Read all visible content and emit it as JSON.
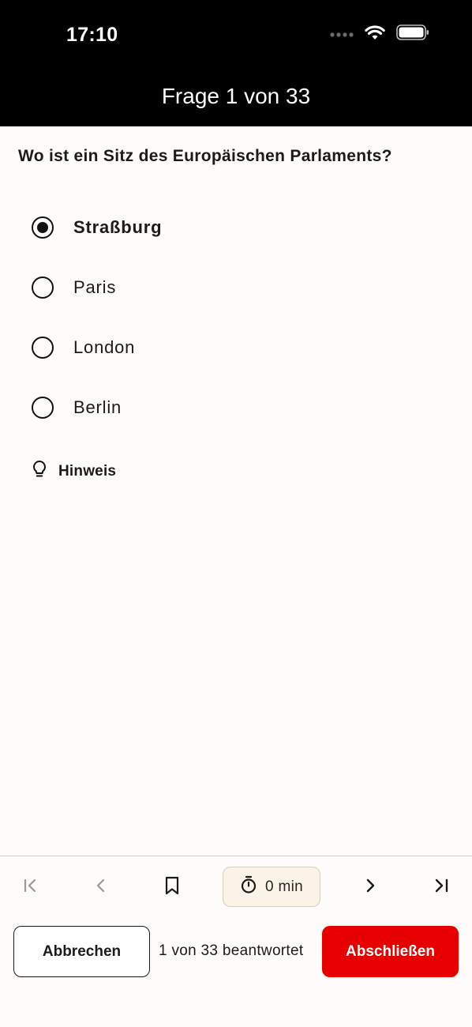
{
  "status_bar": {
    "time": "17:10",
    "icons": [
      "signal-dots-icon",
      "wifi-icon",
      "battery-icon"
    ]
  },
  "header": {
    "title": "Frage 1 von 33"
  },
  "question": {
    "text": "Wo ist ein Sitz des Europäischen Parlaments?",
    "options": [
      {
        "label": "Straßburg",
        "selected": true
      },
      {
        "label": "Paris",
        "selected": false
      },
      {
        "label": "London",
        "selected": false
      },
      {
        "label": "Berlin",
        "selected": false
      }
    ]
  },
  "hint": {
    "label": "Hinweis",
    "icon": "lightbulb-icon"
  },
  "navigation": {
    "icons": [
      "first-page-icon",
      "previous-icon",
      "bookmark-icon",
      "timer-icon",
      "next-icon",
      "last-page-icon"
    ],
    "timer_label": "0 min"
  },
  "footer": {
    "cancel_label": "Abbrechen",
    "progress_text": "1 von 33 beantwortet",
    "finish_label": "Abschließen"
  },
  "colors": {
    "accent": "#e60000",
    "header_bg": "#000000",
    "timer_bg": "#fbf3e8"
  }
}
